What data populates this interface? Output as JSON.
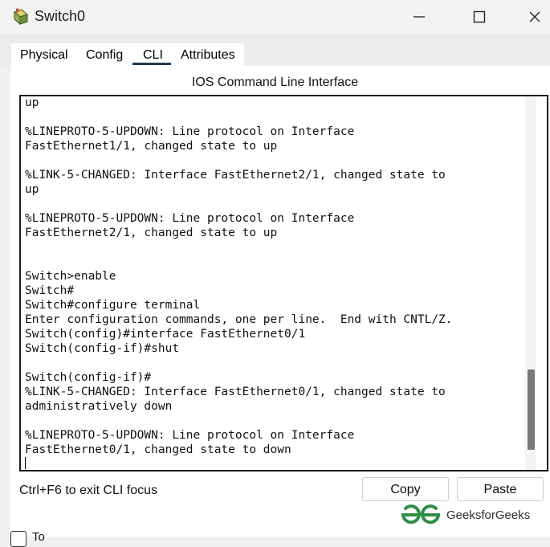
{
  "window": {
    "title": "Switch0",
    "icon": "switch-device-icon",
    "controls": [
      "minimize-icon",
      "maximize-icon",
      "close-icon"
    ]
  },
  "tabs": {
    "items": [
      {
        "label": "Physical"
      },
      {
        "label": "Config"
      },
      {
        "label": "CLI"
      },
      {
        "label": "Attributes"
      }
    ],
    "active": "CLI",
    "active_color": "#1f3a55"
  },
  "cli": {
    "panel_title": "IOS Command Line Interface",
    "terminal_text": "up\n\n%LINEPROTO-5-UPDOWN: Line protocol on Interface\nFastEthernet1/1, changed state to up\n\n%LINK-5-CHANGED: Interface FastEthernet2/1, changed state to\nup\n\n%LINEPROTO-5-UPDOWN: Line protocol on Interface\nFastEthernet2/1, changed state to up\n\n\nSwitch>enable\nSwitch#\nSwitch#configure terminal\nEnter configuration commands, one per line.  End with CNTL/Z.\nSwitch(config)#interface FastEthernet0/1\nSwitch(config-if)#shut\n\nSwitch(config-if)#\n%LINK-5-CHANGED: Interface FastEthernet0/1, changed state to\nadministratively down\n\n%LINEPROTO-5-UPDOWN: Line protocol on Interface\nFastEthernet0/1, changed state to down"
  },
  "footer": {
    "focus_hint": "Ctrl+F6 to exit CLI focus",
    "copy_label": "Copy",
    "paste_label": "Paste",
    "bottom_label": "To"
  },
  "watermark": {
    "text": "GeeksforGeeks",
    "color": "#2f8d46"
  }
}
